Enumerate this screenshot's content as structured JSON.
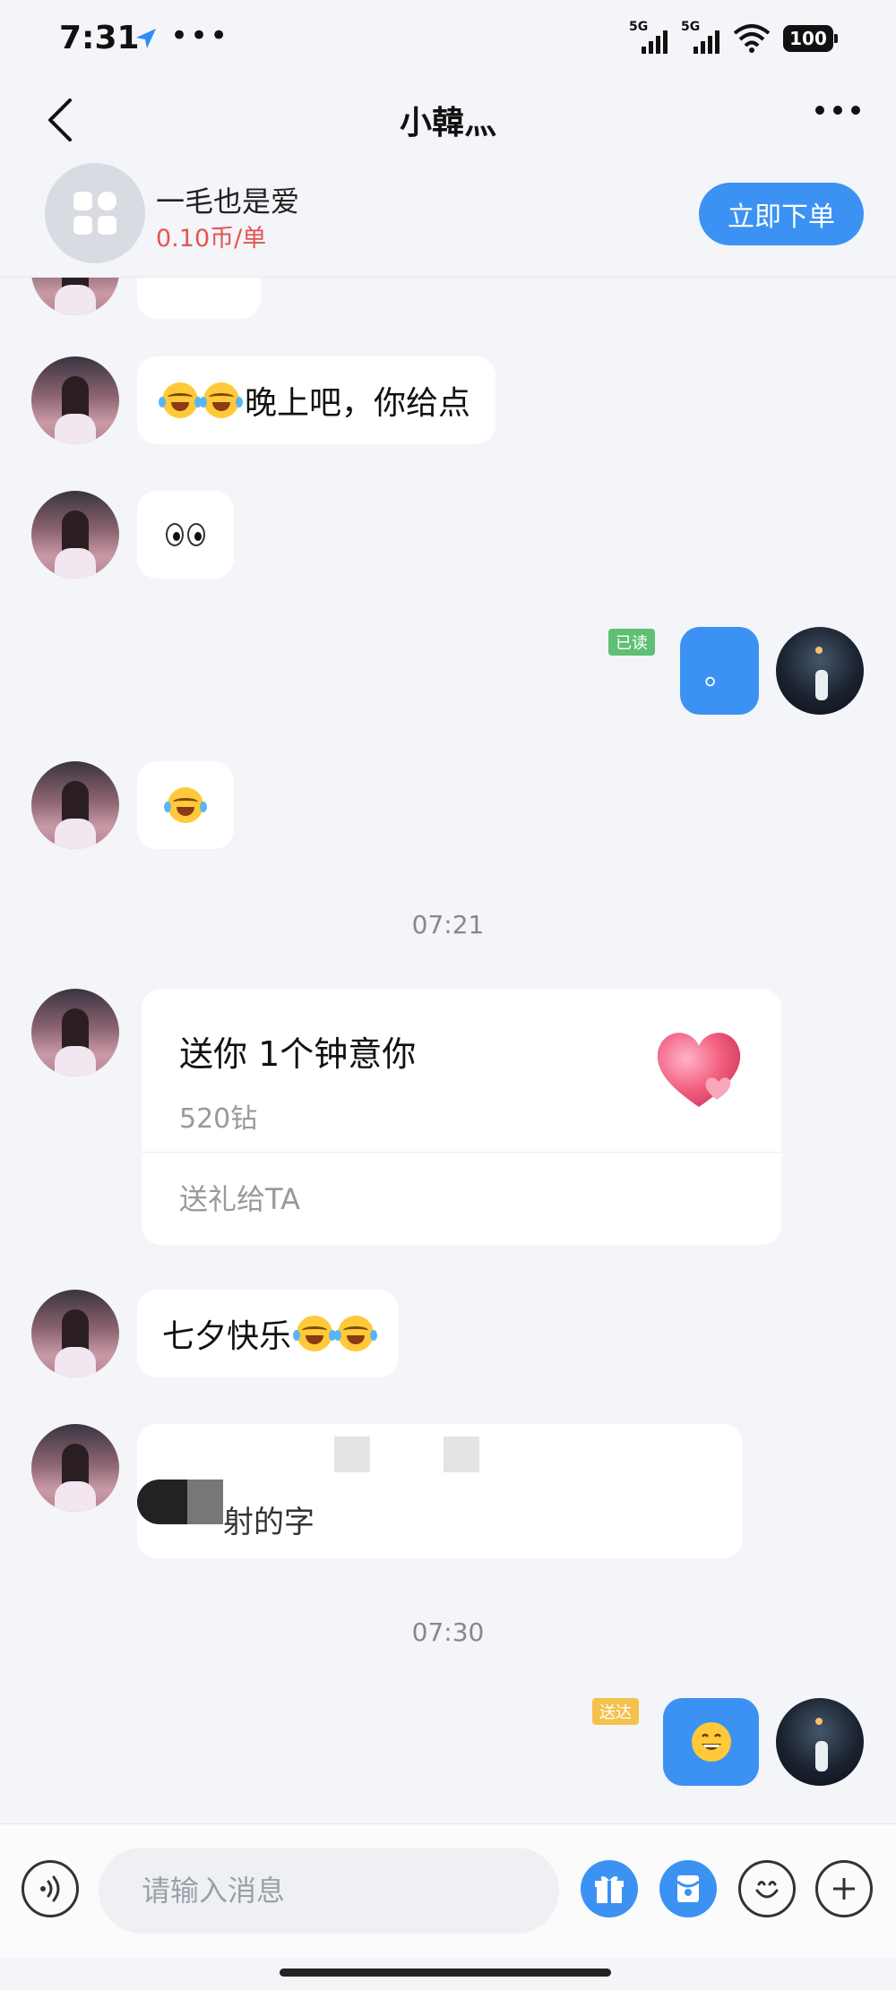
{
  "status_bar": {
    "time": "7:31",
    "signal_labels": [
      "5G",
      "5G"
    ],
    "battery": "100"
  },
  "header": {
    "title": "小韓灬"
  },
  "product": {
    "name": "一毛也是爱",
    "price": "0.10币/单",
    "order_button": "立即下单"
  },
  "messages": [
    {
      "side": "left",
      "text": "晚上吧，你给点",
      "emoji_prefix": "face-with-tears-of-joy x2"
    },
    {
      "side": "left",
      "emoji": "eyes"
    },
    {
      "side": "right",
      "text": "。",
      "status": "已读"
    },
    {
      "side": "left",
      "emoji": "face-with-tears-of-joy"
    }
  ],
  "timestamps": [
    "07:21",
    "07:30"
  ],
  "gift_card": {
    "title": "送你 1个钟意你",
    "cost": "520钻",
    "action": "送礼给TA"
  },
  "messages_after_gift": [
    {
      "side": "left",
      "text": "七夕快乐",
      "emoji_suffix": "face-with-tears-of-joy x2"
    },
    {
      "side": "left",
      "text_partial": "射的字",
      "note_visible": "partially obscured"
    },
    {
      "side": "right",
      "emoji": "grinning-face",
      "status": "送达"
    }
  ],
  "input_bar": {
    "placeholder": "请输入消息"
  },
  "colors": {
    "accent": "#3c92f2",
    "price": "#e55454",
    "read_badge": "#5fbf74",
    "delivered_badge": "#f2c24d",
    "background": "#f3f5f9"
  }
}
